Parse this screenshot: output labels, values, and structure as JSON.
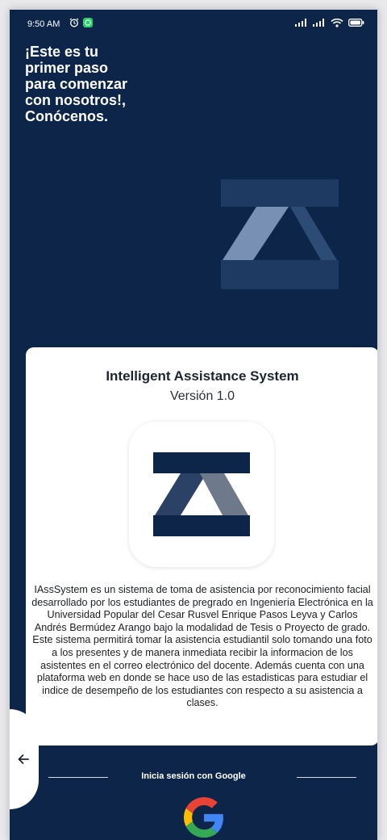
{
  "status_bar": {
    "time": "9:50 AM",
    "icons_left": [
      "alarm-icon",
      "whatsapp-icon"
    ],
    "icons_right": [
      "signal-icon",
      "signal-icon",
      "wifi-icon",
      "battery-icon"
    ]
  },
  "headline": {
    "lines": [
      "¡Este es tu",
      "primer paso",
      "para comenzar",
      "con nosotros!,",
      "Conócenos."
    ]
  },
  "card": {
    "title": "Intelligent Assistance System",
    "version": "Versión 1.0",
    "description": "IAssSystem es un sistema de toma de asistencia por reconocimiento facial desarrollado por los estudiantes de pregrado en Ingeniería Electrónica en la Universidad Popular del Cesar Rusvel Enrique Pasos Leyva y Carlos Andrés Bermúdez Arango bajo la modalidad de Tesis o Proyecto de grado. Este sistema permitirá tomar la asistencia estudiantil solo tomando una foto a los presentes y de manera inmediata recibir la informacion de los asistentes en el correo electrónico del docente. Además cuenta con una plataforma web en donde se hace uso de las estadisticas para estudiar el indice de desempeño de los estudiantes con respecto a su asistencia a clases."
  },
  "google_login": {
    "label": "Inicia sesión con Google"
  },
  "colors": {
    "background": "#0c2548",
    "logo_light": "#7790b4",
    "logo_dim": "#1e3a62",
    "card": "#ffffff",
    "logo_dark": "#0c2548",
    "logo_gray": "#6e7a8c"
  }
}
